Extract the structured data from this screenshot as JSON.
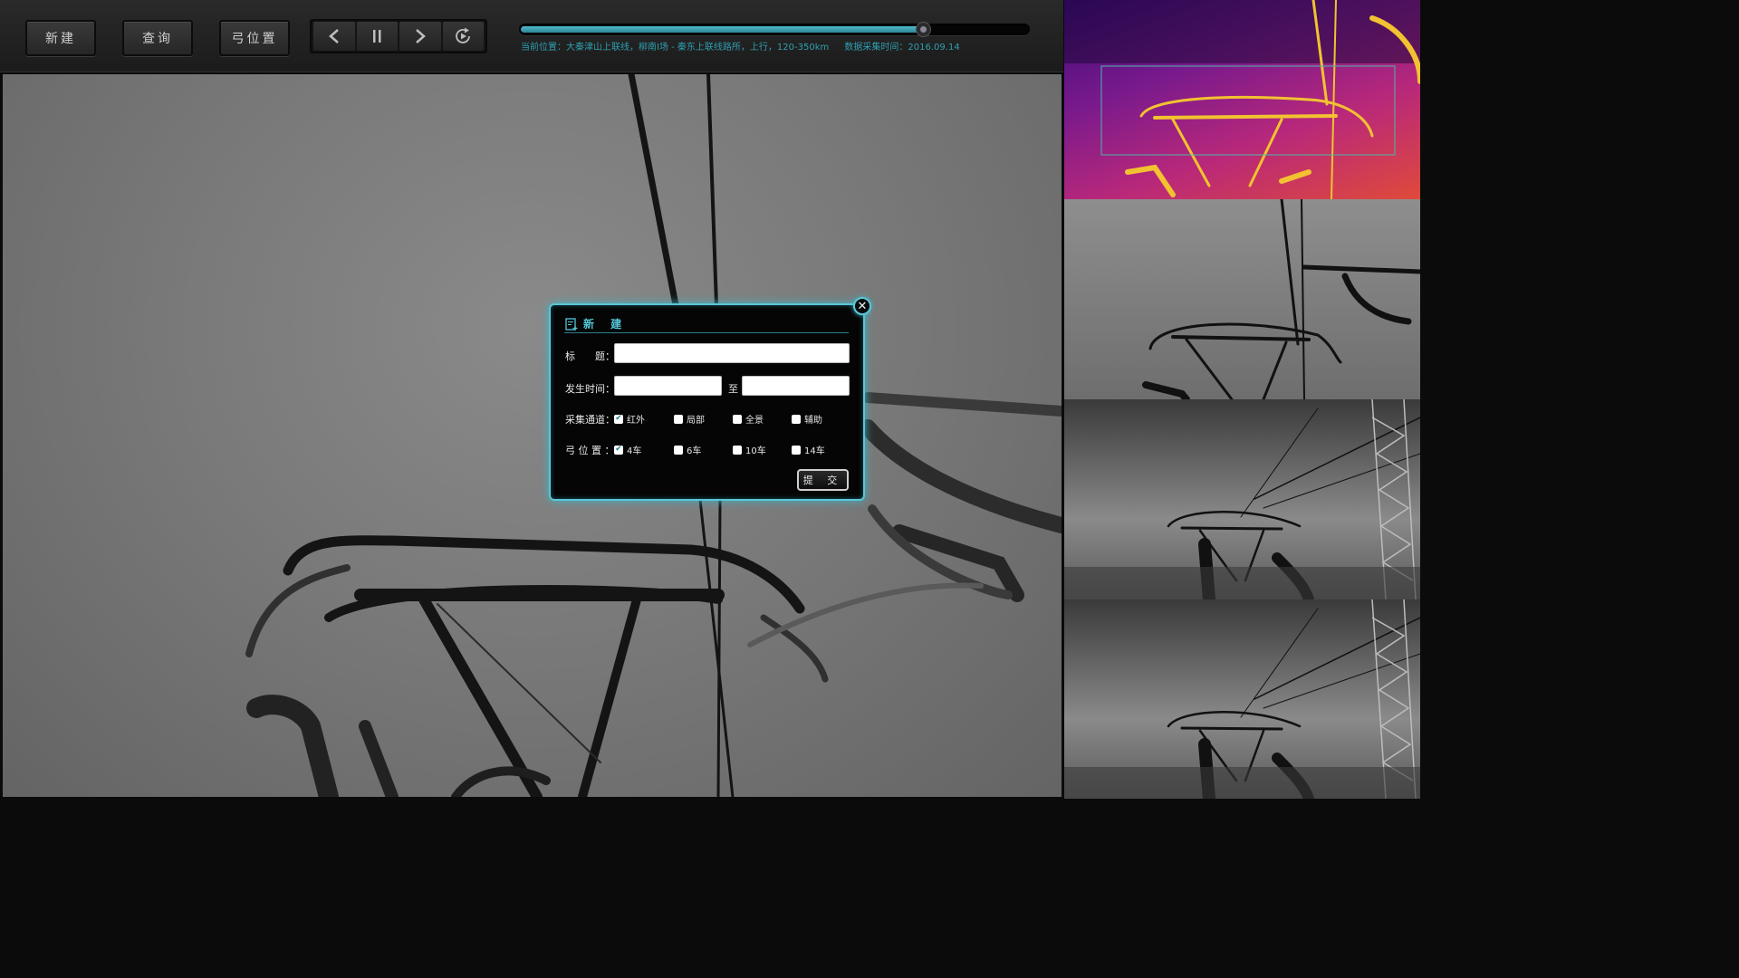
{
  "toolbar": {
    "new_label": "新建",
    "query_label": "查询",
    "bow_position_label": "弓位置"
  },
  "playback": {
    "prev_icon": "chevron-left-icon",
    "pause_icon": "pause-icon",
    "next_icon": "chevron-right-icon",
    "replay_icon": "replay-icon",
    "progress_fraction": 0.79
  },
  "status": {
    "location": "当前位置：大秦津山上联线，柳南I场 - 秦东上联线路所，上行，120-350km",
    "capture_time": "数据采集时间：2016.09.14"
  },
  "modal": {
    "title": "新 建",
    "title_icon": "new-document-icon",
    "close_icon": "close-icon",
    "title_field_label": "标　　题：",
    "title_value": "",
    "time_label": "发生时间：",
    "time_from": "",
    "time_to_label": "至",
    "time_to": "",
    "channel_label": "采集通道：",
    "channels": [
      {
        "label": "红外",
        "checked": true
      },
      {
        "label": "局部",
        "checked": false
      },
      {
        "label": "全景",
        "checked": false
      },
      {
        "label": "辅助",
        "checked": false
      }
    ],
    "bow_label": "弓 位 置 ：",
    "bows": [
      {
        "label": "4车",
        "checked": true
      },
      {
        "label": "6车",
        "checked": false
      },
      {
        "label": "10车",
        "checked": false
      },
      {
        "label": "14车",
        "checked": false
      }
    ],
    "submit_label": "提 交"
  },
  "colors": {
    "accent": "#54c6d8",
    "status_text": "#2f9fb0",
    "progress": "#3a9fb0"
  },
  "thumbnails": [
    {
      "kind": "infrared"
    },
    {
      "kind": "local"
    },
    {
      "kind": "panorama"
    },
    {
      "kind": "auxiliary"
    }
  ]
}
